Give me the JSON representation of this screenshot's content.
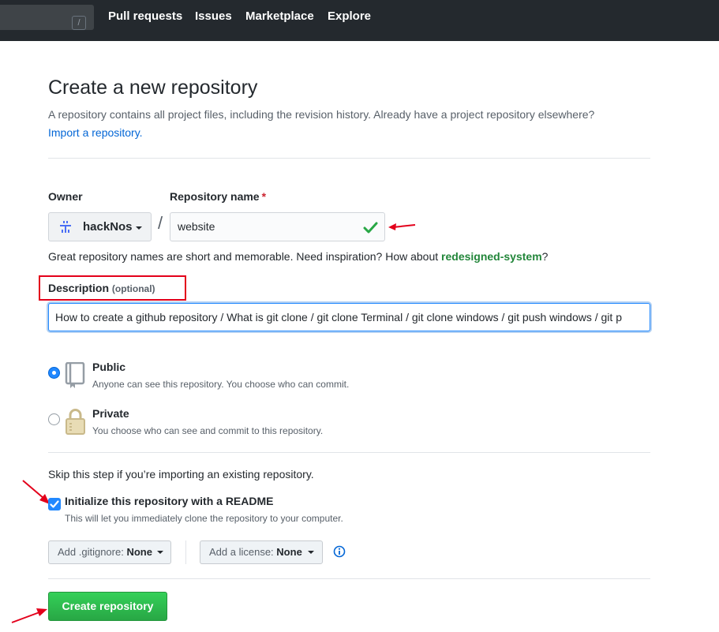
{
  "topbar": {
    "search_hint": "/",
    "nav": [
      "Pull requests",
      "Issues",
      "Marketplace",
      "Explore"
    ]
  },
  "page": {
    "title": "Create a new repository",
    "subtitle": "A repository contains all project files, including the revision history. Already have a project repository elsewhere?",
    "import_link": "Import a repository."
  },
  "form": {
    "owner_label": "Owner",
    "owner_value": "hackNos",
    "separator": "/",
    "repo_name_label": "Repository name",
    "required_mark": "*",
    "repo_name_value": "website",
    "hint_prefix": "Great repository names are short and memorable. Need inspiration? How about",
    "hint_suggestion": "redesigned-system",
    "hint_suffix": "?",
    "description_label": "Description",
    "description_optional": "(optional)",
    "description_value": "How to create a github repository / What is git clone / git clone Terminal / git clone windows / git push windows / git p"
  },
  "visibility": {
    "public_title": "Public",
    "public_desc": "Anyone can see this repository. You choose who can commit.",
    "private_title": "Private",
    "private_desc": "You choose who can see and commit to this repository.",
    "selected": "Public"
  },
  "init": {
    "skip_text": "Skip this step if you’re importing an existing repository.",
    "readme_label": "Initialize this repository with a README",
    "readme_desc": "This will let you immediately clone the repository to your computer.",
    "readme_checked": true
  },
  "extras": {
    "gitignore_prefix": "Add .gitignore:",
    "gitignore_value": "None",
    "license_prefix": "Add a license:",
    "license_value": "None"
  },
  "actions": {
    "create_label": "Create repository"
  },
  "colors": {
    "topbar": "#24292e",
    "link": "#0366d6",
    "primary_button": "#28a745",
    "annotation": "#e3001b"
  }
}
